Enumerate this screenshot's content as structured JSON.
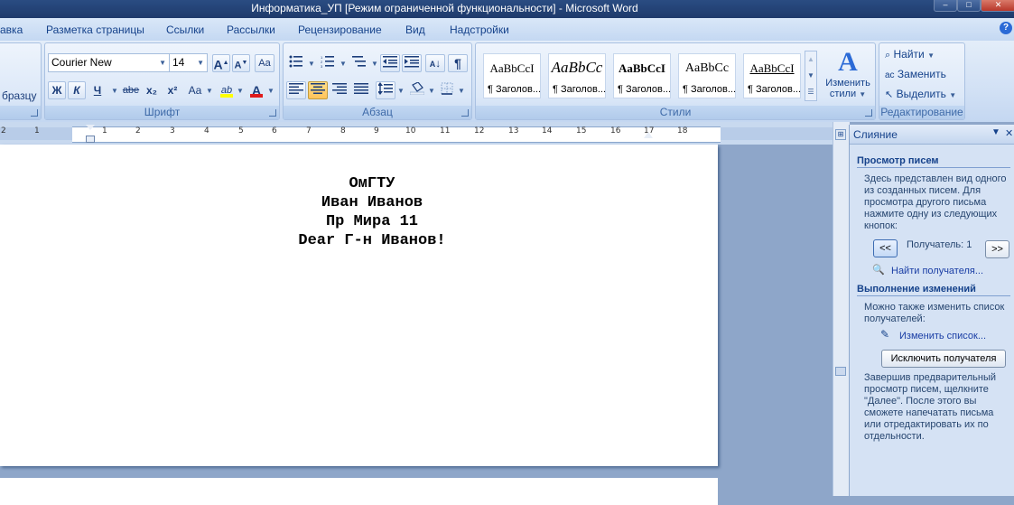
{
  "window": {
    "title": "Информатика_УП [Режим ограниченной функциональности] - Microsoft Word",
    "minimize": "–",
    "maximize": "□",
    "close": "✕"
  },
  "tabs": [
    "авка",
    "Разметка страницы",
    "Ссылки",
    "Рассылки",
    "Рецензирование",
    "Вид",
    "Надстройки"
  ],
  "help_glyph": "?",
  "ribbon": {
    "clipboard": {
      "format_painter_label": "бразцу"
    },
    "font": {
      "label": "Шрифт",
      "font_name": "Courier New",
      "font_size": "14",
      "grow": "A",
      "shrink": "A",
      "bold": "Ж",
      "italic": "К",
      "underline": "Ч",
      "strike": "abe",
      "subscript": "x₂",
      "superscript": "x²",
      "case": "Aa",
      "highlight": "ab",
      "font_color": "A",
      "highlight_color": "#ffff00",
      "font_color_value": "#e01b1b"
    },
    "paragraph": {
      "label": "Абзац",
      "pilcrow": "¶",
      "sort": "↓"
    },
    "styles": {
      "label": "Стили",
      "items": [
        {
          "sample": "AaBbCcI",
          "name": "¶ Заголов..."
        },
        {
          "sample": "AaBbCc",
          "name": "¶ Заголов..."
        },
        {
          "sample": "AaBbCcI",
          "name": "¶ Заголов..."
        },
        {
          "sample": "AaBbCc",
          "name": "¶ Заголов..."
        },
        {
          "sample": "AaBbCcI",
          "name": "¶ Заголов..."
        }
      ],
      "change_styles_line1": "Изменить",
      "change_styles_line2": "стили",
      "change_icon_letter": "A"
    },
    "editing": {
      "label": "Редактирование",
      "find": "Найти",
      "replace": "Заменить",
      "select": "Выделить"
    }
  },
  "ruler": {
    "ticks": [
      "2",
      "1",
      "1",
      "2",
      "3",
      "4",
      "5",
      "6",
      "7",
      "8",
      "9",
      "10",
      "11",
      "12",
      "13",
      "14",
      "15",
      "16",
      "17",
      "18"
    ]
  },
  "document": {
    "lines": [
      "ОмГТУ",
      "Иван Иванов",
      "Пр Мира 11",
      "Dear Г-н Иванов!"
    ]
  },
  "taskpane": {
    "title": "Слияние",
    "section1_title": "Просмотр писем",
    "section1_text": "Здесь представлен вид одного из созданных писем. Для просмотра другого письма нажмите одну из следующих кнопок:",
    "prev_label": "<<",
    "next_label": ">>",
    "recipient_label": "Получатель: 1",
    "find_recipient": "Найти получателя...",
    "section2_title": "Выполнение изменений",
    "section2_text": "Можно также изменить список получателей:",
    "edit_list": "Изменить список...",
    "exclude_button": "Исключить получателя",
    "footer_text": "Завершив предварительный просмотр писем, щелкните \"Далее\". После этого вы сможете напечатать письма или отредактировать их по отдельности."
  }
}
